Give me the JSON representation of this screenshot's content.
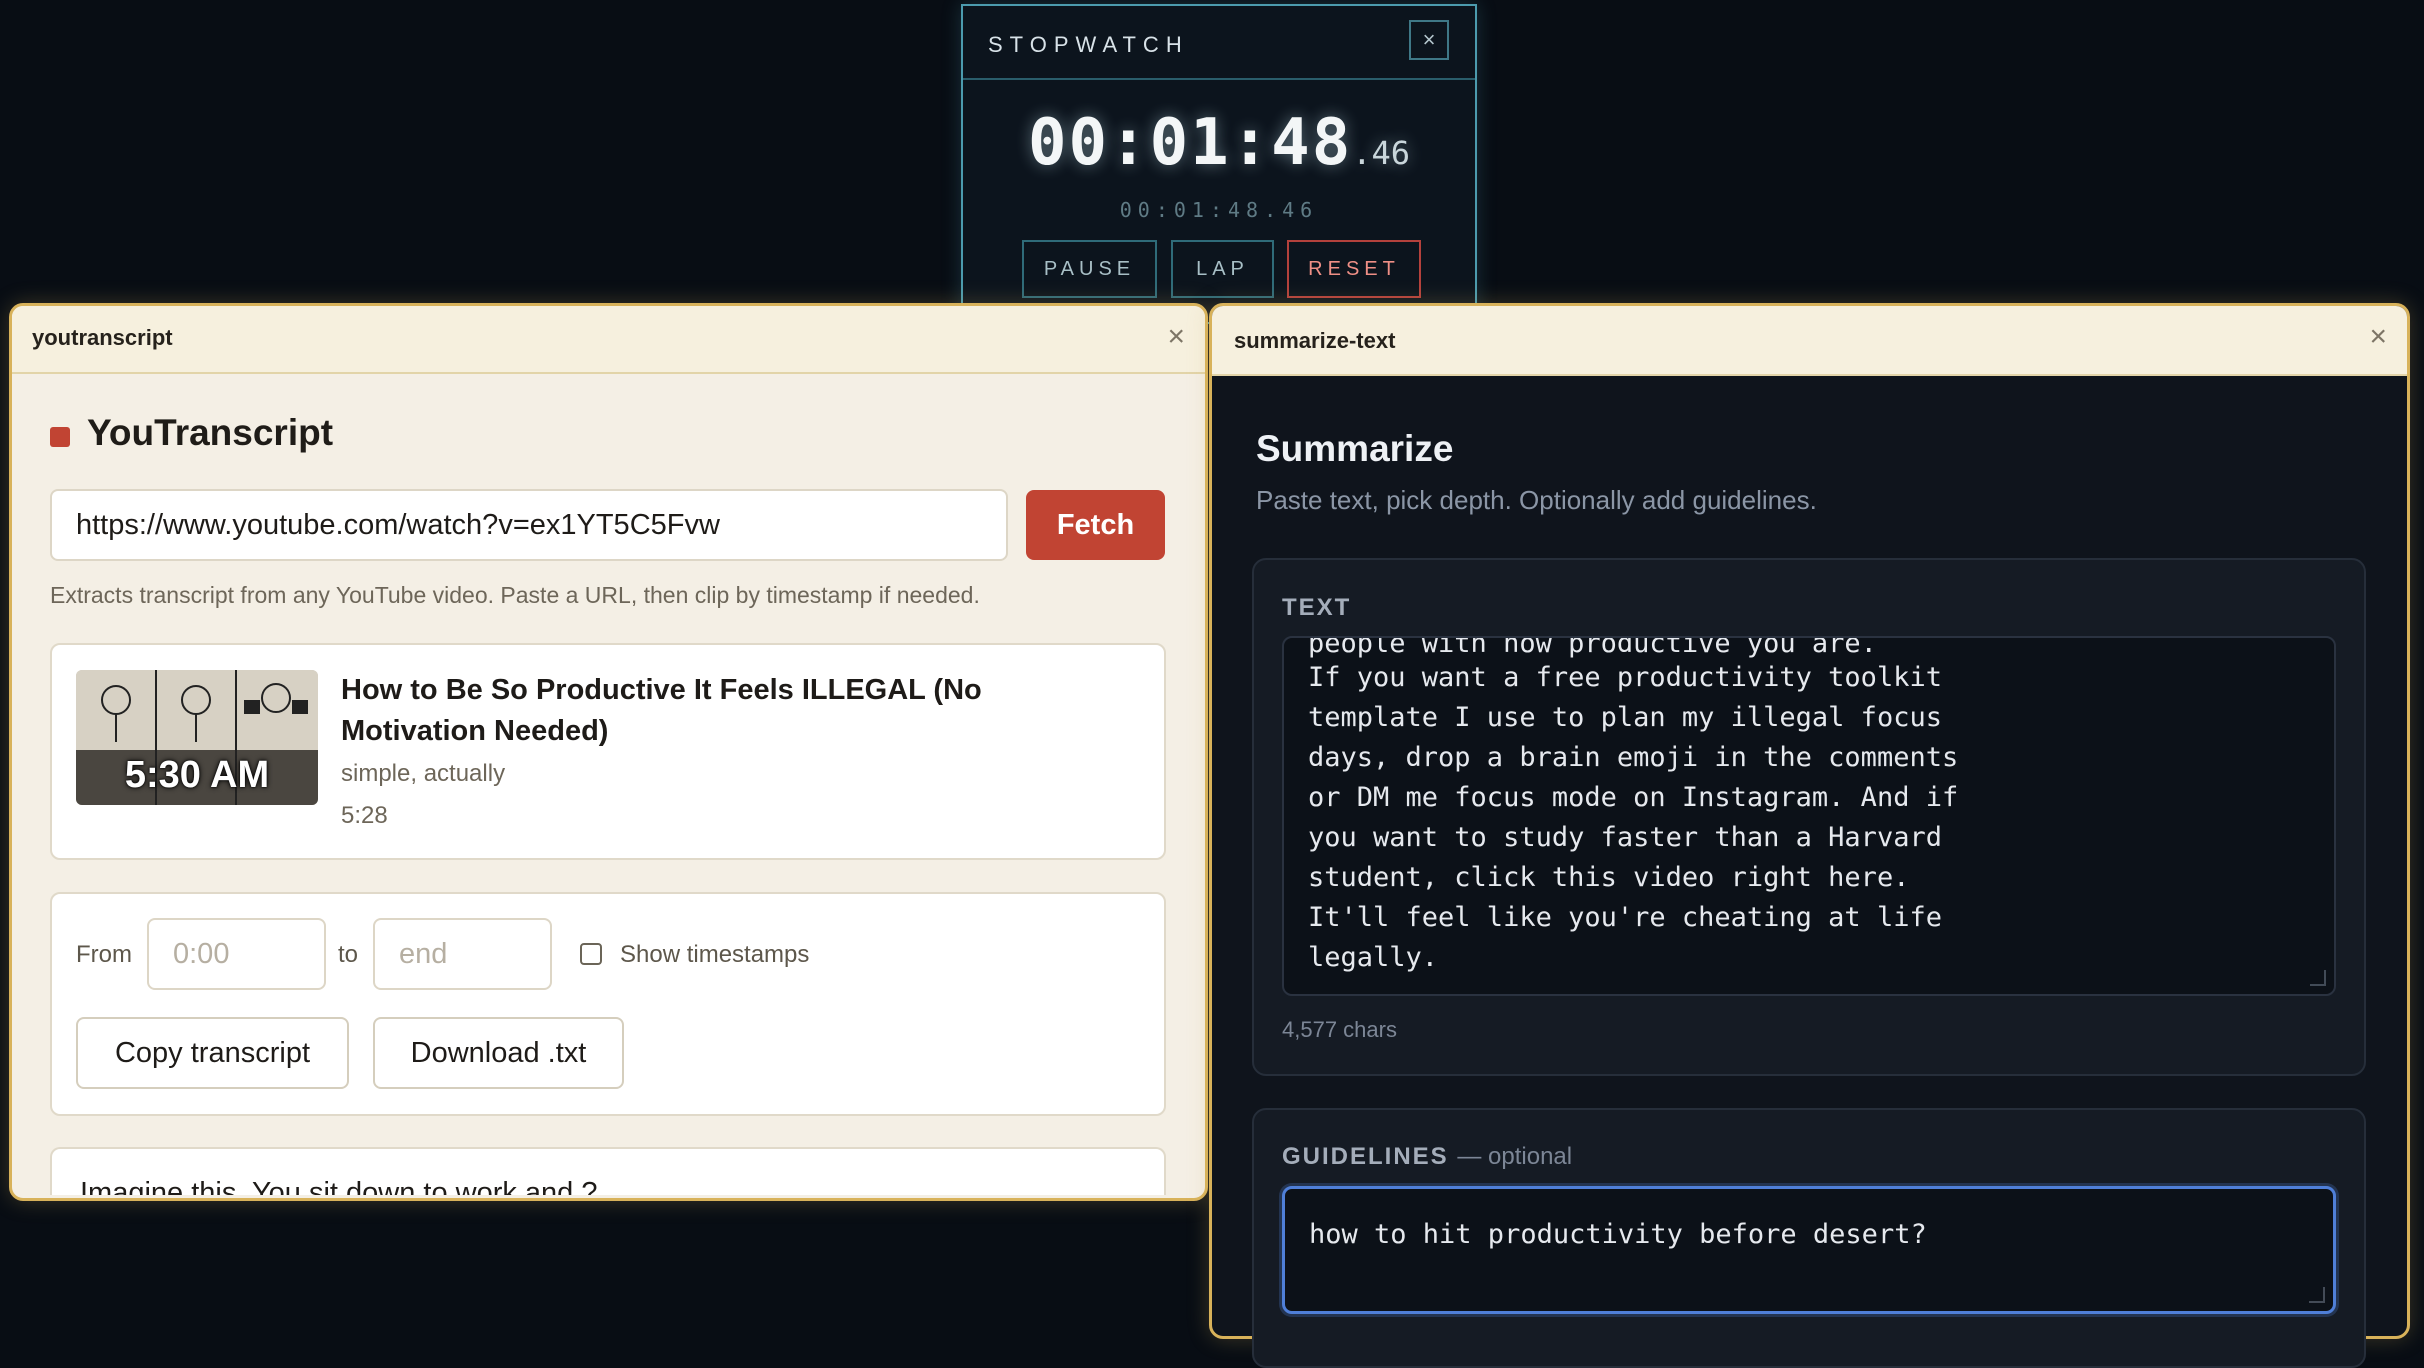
{
  "stopwatch": {
    "title": "STOPWATCH",
    "close": "×",
    "time_main": "00:01:48",
    "time_frac": ".46",
    "time_sub": "00:01:48.46",
    "buttons": {
      "pause": "PAUSE",
      "lap": "LAP",
      "reset": "RESET"
    }
  },
  "youtranscript": {
    "window_title": "youtranscript",
    "close": "×",
    "heading": "YouTranscript",
    "url_value": "https://www.youtube.com/watch?v=ex1YT5C5Fvw",
    "fetch_label": "Fetch",
    "help_text": "Extracts transcript from any YouTube video. Paste a URL, then clip by timestamp if needed.",
    "video": {
      "thumbnail_text": "5:30 AM",
      "title": "How to Be So Productive It Feels ILLEGAL (No Motivation Needed)",
      "channel": "simple, actually",
      "duration": "5:28"
    },
    "clip": {
      "from_label": "From",
      "from_placeholder": "0:00",
      "to_label": "to",
      "to_placeholder": "end",
      "show_timestamps_label": "Show timestamps"
    },
    "actions": {
      "copy": "Copy transcript",
      "download": "Download .txt"
    },
    "transcript_snippet": "Imagine this. You sit down to work and ?"
  },
  "summarize": {
    "window_title": "summarize-text",
    "close": "×",
    "heading": "Summarize",
    "subheading": "Paste text, pick depth. Optionally add guidelines.",
    "text_label": "TEXT",
    "text_cut_line": "people with how productive you are.",
    "text_lines": "If you want a free productivity toolkit\ntemplate I use to plan my illegal focus\ndays, drop a brain emoji in the comments\nor DM me focus mode on Instagram. And if\nyou want to study faster than a Harvard\nstudent, click this video right here.\nIt'll feel like you're cheating at life\nlegally.",
    "char_count": "4,577 chars",
    "guidelines_label": "GUIDELINES",
    "guidelines_optional": "— optional",
    "guidelines_value": "how to hit productivity before desert?"
  },
  "colors": {
    "accent_red": "#c14433",
    "window_border": "#d8b25a",
    "stopwatch_cyan": "#4c9bae"
  }
}
